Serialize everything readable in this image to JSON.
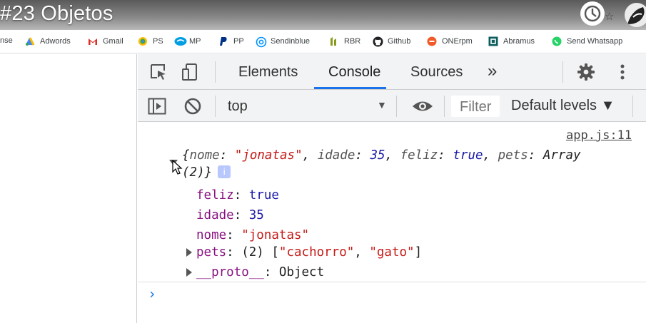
{
  "video": {
    "title": "#23 Objetos"
  },
  "bookmarks": [
    {
      "label": "nse",
      "icon": "none"
    },
    {
      "label": "Adwords",
      "icon": "adwords-icon",
      "color": "#4285f4"
    },
    {
      "label": "Gmail",
      "icon": "gmail-icon",
      "color": "#d93025"
    },
    {
      "label": "PS",
      "icon": "ps-icon",
      "color": "#4285f4"
    },
    {
      "label": "MP",
      "icon": "mp-icon",
      "color": "#009ee3"
    },
    {
      "label": "PP",
      "icon": "paypal-icon",
      "color": "#003087"
    },
    {
      "label": "Sendinblue",
      "icon": "sendinblue-icon",
      "color": "#0092ff"
    },
    {
      "label": "RBR",
      "icon": "rbr-icon",
      "color": "#8a9a1b"
    },
    {
      "label": "Github",
      "icon": "github-icon",
      "color": "#202124"
    },
    {
      "label": "ONErpm",
      "icon": "onerpm-icon",
      "color": "#ef5a28"
    },
    {
      "label": "Abramus",
      "icon": "abramus-icon",
      "color": "#0b5e5e"
    },
    {
      "label": "Send Whatsapp",
      "icon": "whatsapp-icon",
      "color": "#25d366"
    }
  ],
  "devtools": {
    "tabs": [
      "Elements",
      "Console",
      "Sources"
    ],
    "active_tab": "Console",
    "more_tabs": "»",
    "context": "top",
    "filter_placeholder": "Filter",
    "levels": "Default levels ▼",
    "accent": "#1a73e8"
  },
  "console": {
    "source": "app.js:11",
    "object_preview": {
      "open": "{",
      "k_nome": "nome",
      "v_nome": "\"jonatas\"",
      "k_idade": "idade",
      "v_idade": "35",
      "k_feliz": "feliz",
      "v_feliz": "true",
      "k_pets": "pets",
      "v_pets_1": "Array",
      "v_pets_2": "(2)}",
      "info": "i"
    },
    "props": [
      {
        "key": "feliz",
        "value": "true"
      },
      {
        "key": "idade",
        "value": "35"
      },
      {
        "key": "nome",
        "value": "\"jonatas\""
      }
    ],
    "pets": {
      "key": "pets",
      "prefix": "(2) [",
      "item1": "\"cachorro\"",
      "sep": ", ",
      "item2": "\"gato\"",
      "suffix": "]"
    },
    "proto": {
      "key": "__proto__",
      "value": "Object"
    },
    "prompt": "›"
  }
}
